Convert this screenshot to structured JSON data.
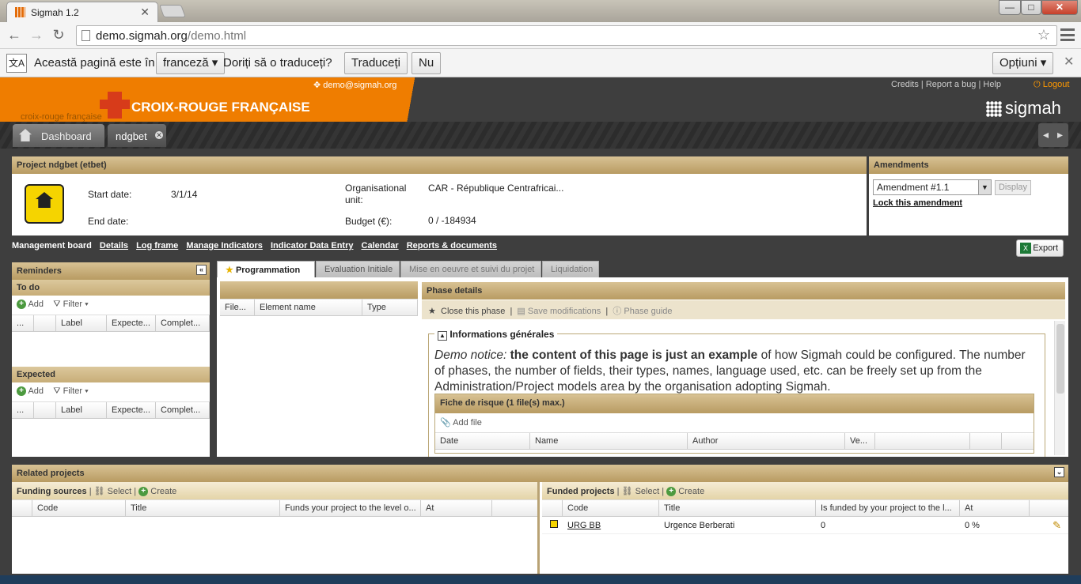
{
  "browser": {
    "tab_title": "Sigmah 1.2",
    "url_host": "demo.sigmah.org",
    "url_path": "/demo.html",
    "minimize": "—",
    "maximize": "□",
    "close": "✕"
  },
  "translate_bar": {
    "text1": "Această pagină este în",
    "language": "franceză",
    "text2": "Doriți să o traduceți?",
    "translate_btn": "Traduceți",
    "no_btn": "Nu",
    "options_btn": "Opțiuni"
  },
  "header": {
    "user_email": "demo@sigmah.org",
    "credits": "Credits",
    "report_bug": "Report a bug",
    "help": "Help",
    "logout": "Logout",
    "brand": "CROIX-ROUGE FRANÇAISE",
    "brand_small": "croix-rouge française",
    "sigmah": "sigmah"
  },
  "app_tabs": {
    "dashboard": "Dashboard",
    "project": "ndgbet"
  },
  "project": {
    "header": "Project ndgbet (etbet)",
    "start_label": "Start date:",
    "start_value": "3/1/14",
    "end_label": "End date:",
    "org_label": "Organisational unit:",
    "org_value": "CAR - République Centrafricai...",
    "budget_label": "Budget (€):",
    "budget_value": "0 / -184934"
  },
  "amendments": {
    "header": "Amendments",
    "selected": "Amendment #1.1",
    "display_btn": "Display",
    "lock_link": "Lock this amendment"
  },
  "nav_links": [
    "Management board",
    "Details",
    "Log frame",
    "Manage Indicators",
    "Indicator Data Entry",
    "Calendar",
    "Reports & documents"
  ],
  "export_btn": "Export",
  "reminders": {
    "header": "Reminders",
    "todo": "To do",
    "expected": "Expected",
    "add": "Add",
    "filter": "Filter",
    "cols": [
      "...",
      "",
      "Label",
      "Expecte...",
      "Complet..."
    ]
  },
  "phase_tabs": [
    "Programmation",
    "Evaluation Initiale",
    "Mise en oeuvre et suivi du projet",
    "Liquidation"
  ],
  "files_cols": [
    "File...",
    "Element name",
    "Type"
  ],
  "phase": {
    "header": "Phase details",
    "close_phase": "Close this phase",
    "save": "Save modifications",
    "guide": "Phase guide",
    "section": "Informations générales",
    "notice_italic": "Demo notice:",
    "notice_bold": "the content of this page is just an example",
    "notice_rest": "of how Sigmah could be configured. The number of phases, the number of fields, their types, names, language used, etc. can be freely set up from the Administration/Project models area by the organisation adopting Sigmah.",
    "fiche_header": "Fiche de risque (1 file(s) max.)",
    "add_file": "Add file",
    "fiche_cols": [
      "Date",
      "Name",
      "Author",
      "Ve..."
    ]
  },
  "related": {
    "header": "Related projects",
    "funding_title": "Funding sources",
    "funded_title": "Funded projects",
    "select": "Select",
    "create": "Create",
    "funding_cols": [
      "Code",
      "Title",
      "Funds your project to the level o...",
      "At"
    ],
    "funded_cols": [
      "Code",
      "Title",
      "Is funded by your project to the l...",
      "At"
    ],
    "funded_rows": [
      {
        "code": "URG BB",
        "title": "Urgence Berberati",
        "amount": "0",
        "at": "0 %"
      }
    ]
  }
}
